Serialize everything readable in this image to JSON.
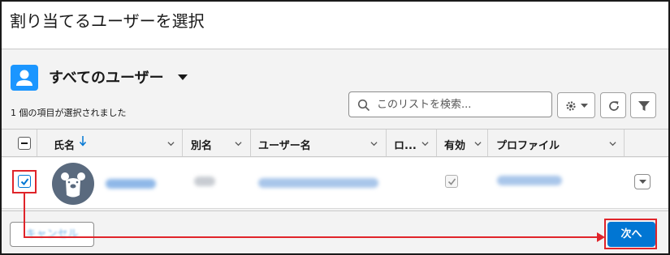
{
  "dialog": {
    "title": "割り当てるユーザーを選択"
  },
  "list_view": {
    "name": "すべてのユーザー",
    "selected_count_text": "1 個の項目が選択されました"
  },
  "search": {
    "placeholder": "このリストを検索..."
  },
  "toolbar": {
    "settings_icon": "gear-icon",
    "refresh_icon": "refresh-icon",
    "filter_icon": "filter-icon"
  },
  "table": {
    "columns": [
      {
        "label": "氏名",
        "sorted": "descending"
      },
      {
        "label": "別名"
      },
      {
        "label": "ユーザー名"
      },
      {
        "label": "ロ..."
      },
      {
        "label": "有効"
      },
      {
        "label": "プロファイル"
      }
    ],
    "rows": [
      {
        "selected": true,
        "active": true,
        "avatar_icon": "bear-avatar-icon"
      }
    ]
  },
  "footer": {
    "cancel_label": "キャンセル",
    "next_label": "次へ"
  },
  "colors": {
    "brand": "#0176d3",
    "annotation": "#e0242a"
  }
}
